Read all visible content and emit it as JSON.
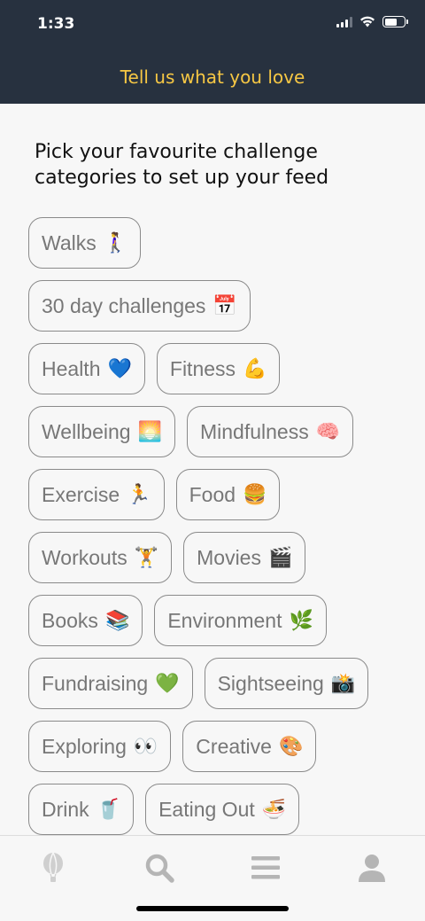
{
  "status": {
    "time": "1:33"
  },
  "header": {
    "title": "Tell us what you love"
  },
  "intro": "Pick your favourite challenge categories to set up your feed",
  "categories": [
    [
      {
        "label": "Walks",
        "emoji": "🚶‍♀️"
      }
    ],
    [
      {
        "label": "30 day challenges",
        "emoji": "📅"
      }
    ],
    [
      {
        "label": "Health",
        "emoji": "💙"
      },
      {
        "label": "Fitness",
        "emoji": "💪"
      }
    ],
    [
      {
        "label": "Wellbeing",
        "emoji": "🌅"
      },
      {
        "label": "Mindfulness",
        "emoji": "🧠"
      }
    ],
    [
      {
        "label": "Exercise",
        "emoji": "🏃"
      },
      {
        "label": "Food",
        "emoji": "🍔"
      }
    ],
    [
      {
        "label": "Workouts",
        "emoji": "🏋️"
      },
      {
        "label": "Movies",
        "emoji": "🎬"
      }
    ],
    [
      {
        "label": "Books",
        "emoji": "📚"
      },
      {
        "label": "Environment",
        "emoji": "🌿"
      }
    ],
    [
      {
        "label": "Fundraising",
        "emoji": "💚"
      },
      {
        "label": "Sightseeing",
        "emoji": "📸"
      }
    ],
    [
      {
        "label": "Exploring",
        "emoji": "👀"
      },
      {
        "label": "Creative",
        "emoji": "🎨"
      }
    ],
    [
      {
        "label": "Drink",
        "emoji": "🥤"
      },
      {
        "label": "Eating Out",
        "emoji": "🍜"
      }
    ]
  ],
  "tabbar": {
    "items": [
      {
        "name": "balloon-icon"
      },
      {
        "name": "search-icon"
      },
      {
        "name": "menu-icon"
      },
      {
        "name": "profile-icon"
      }
    ]
  },
  "colors": {
    "header_bg": "#27313f",
    "header_title": "#f6c744",
    "chip_border": "#8a8a8a",
    "chip_text": "#777777",
    "tab_icon": "#b5b5b5"
  }
}
